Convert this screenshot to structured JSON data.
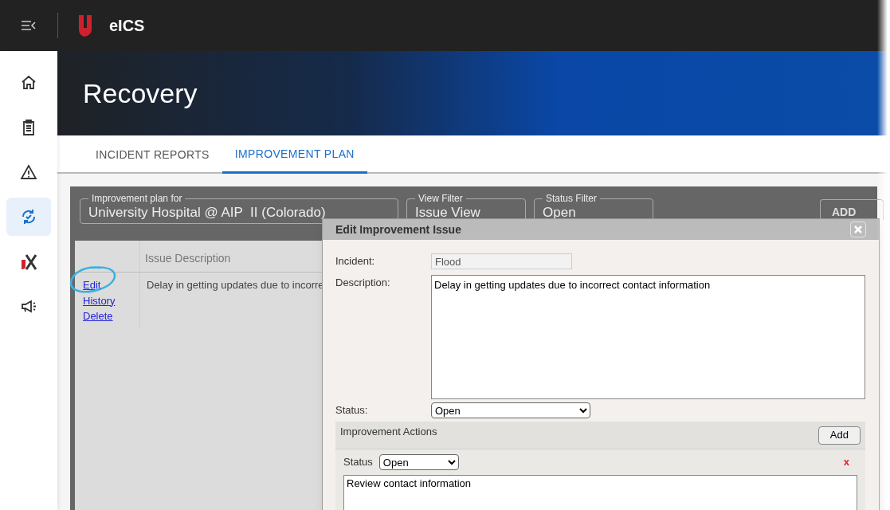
{
  "app": {
    "title": "eICS"
  },
  "nav_items": [
    {
      "kind": "home",
      "selected": false
    },
    {
      "kind": "clipboard",
      "selected": false
    },
    {
      "kind": "alert",
      "selected": false
    },
    {
      "kind": "recovery",
      "selected": true
    },
    {
      "kind": "logo",
      "selected": false
    },
    {
      "kind": "megaphone",
      "selected": false
    }
  ],
  "page_title": "Recovery",
  "tabs": [
    {
      "label": "INCIDENT REPORTS",
      "selected": false
    },
    {
      "label": "IMPROVEMENT PLAN",
      "selected": true
    }
  ],
  "filters": [
    {
      "label": "Improvement plan for",
      "value": "University Hospital @ AIP  II (Colorado)"
    },
    {
      "label": "View Filter",
      "value": "Issue View"
    },
    {
      "label": "Status Filter",
      "value": "Open"
    }
  ],
  "add_button": "ADD",
  "table": {
    "columns": [
      "Issue Description"
    ],
    "rows": [
      {
        "links": [
          "Edit",
          "History",
          "Delete"
        ],
        "issue_description": "Delay in getting updates due to incorre"
      }
    ]
  },
  "dialog": {
    "title": "Edit Improvement Issue",
    "incident_label": "Incident:",
    "incident": "Flood",
    "description_label": "Description:",
    "description": "Delay in getting updates due to incorrect contact information",
    "status_label": "Status:",
    "status": "Open",
    "actions_title": "Improvement Actions",
    "add_button": "Add",
    "actions": [
      {
        "status_label": "Status",
        "status": "Open",
        "delete": "x",
        "text": "Review contact information"
      }
    ]
  }
}
